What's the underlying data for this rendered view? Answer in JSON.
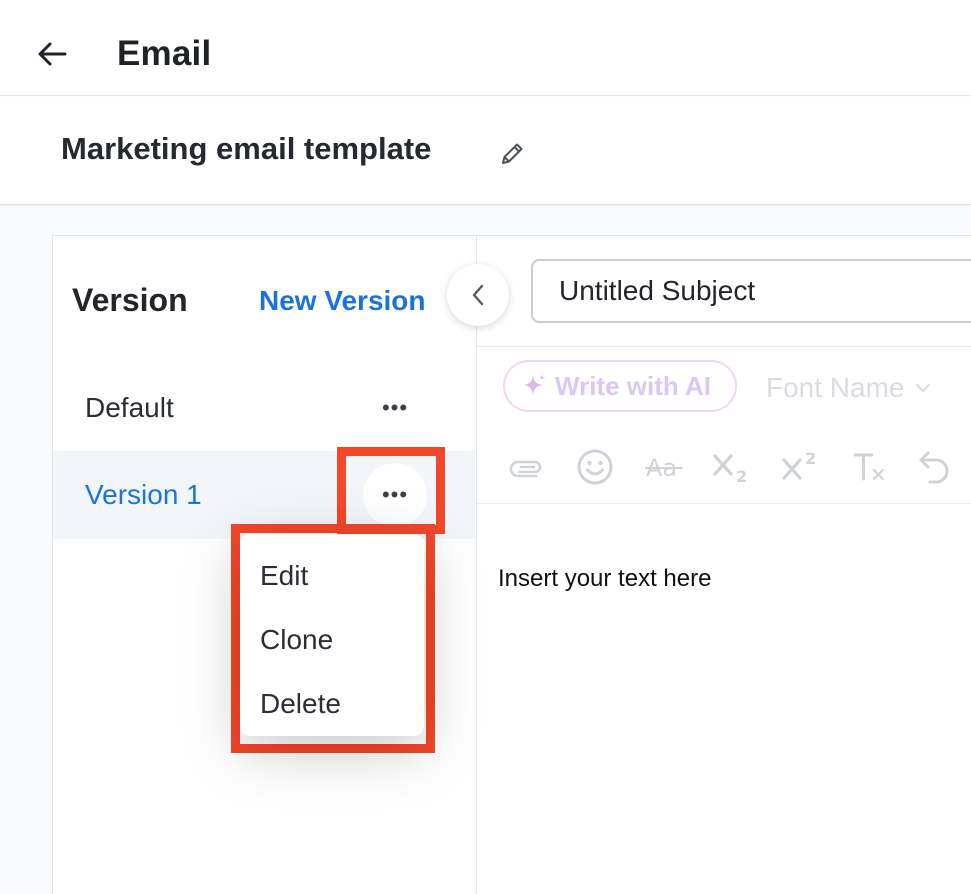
{
  "header": {
    "title": "Email",
    "back_icon": "arrow-left-icon"
  },
  "template": {
    "name": "Marketing email template",
    "edit_icon": "pencil-icon"
  },
  "versions": {
    "heading": "Version",
    "new_version_label": "New Version",
    "collapse_icon": "chevron-left-icon",
    "items": [
      {
        "label": "Default",
        "active": false
      },
      {
        "label": "Version 1",
        "active": true
      }
    ],
    "more_icon": "more-horizontal-icon"
  },
  "context_menu": {
    "items": [
      "Edit",
      "Clone",
      "Delete"
    ]
  },
  "editor": {
    "subject_value": "Untitled Subject",
    "ai_button_label": "Write with AI",
    "ai_icon": "sparkle-icon",
    "font_select_value": "Font Name",
    "toolbar_icons": [
      "attachment-icon",
      "emoji-icon",
      "strikethrough-icon",
      "subscript-icon",
      "superscript-icon",
      "clear-format-icon",
      "undo-icon"
    ],
    "body_text": "Insert your text here"
  },
  "colors": {
    "accent": "#1a73d9",
    "highlight": "#f4472a",
    "active_row_bg": "#f2f5f9"
  }
}
